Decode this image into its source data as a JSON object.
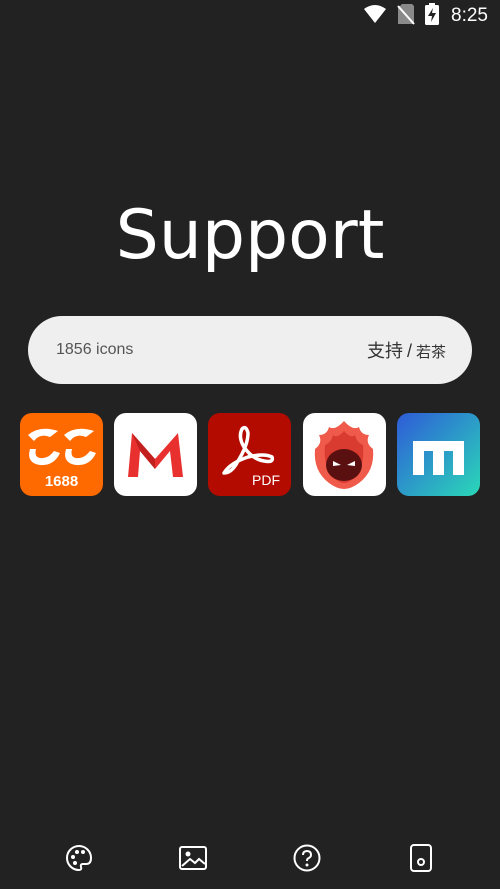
{
  "status_bar": {
    "time": "8:25",
    "icons": [
      "wifi-icon",
      "no-sim-icon",
      "battery-charging-icon"
    ]
  },
  "main": {
    "title": "Support",
    "search": {
      "count_label": "1856 icons",
      "support_label": "支持",
      "separator": "/",
      "support_sub_label": "若茶"
    }
  },
  "apps": [
    {
      "name": "1688",
      "label": "1688",
      "icon": "alibaba-1688-icon",
      "color": "#ff6a00"
    },
    {
      "name": "Gmail-style M",
      "icon": "red-m-icon",
      "color": "#ffffff"
    },
    {
      "name": "Adobe Acrobat",
      "label": "PDF",
      "icon": "adobe-pdf-icon",
      "color": "#b30b00"
    },
    {
      "name": "AnTuTu",
      "icon": "antutu-icon",
      "color": "#ffffff"
    },
    {
      "name": "Maxthon",
      "icon": "maxthon-icon",
      "color": "#2e6fd6"
    }
  ],
  "bottom_nav": [
    {
      "icon": "palette-icon"
    },
    {
      "icon": "image-icon"
    },
    {
      "icon": "help-icon"
    },
    {
      "icon": "tablet-icon"
    }
  ],
  "colors": {
    "background": "#222222",
    "search_bar": "#efefef",
    "text": "#ffffff"
  }
}
